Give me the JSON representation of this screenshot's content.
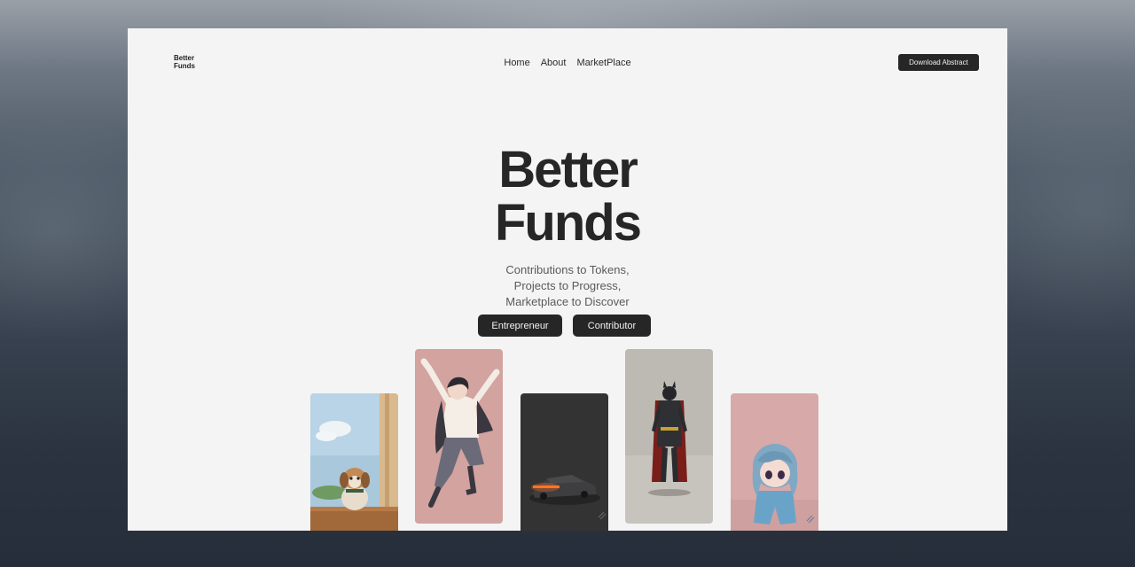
{
  "brand": {
    "line1": "Better",
    "line2": "Funds"
  },
  "nav": {
    "items": [
      "Home",
      "About",
      "MarketPlace"
    ]
  },
  "header": {
    "download_label": "Download Abstract"
  },
  "hero": {
    "title_line1": "Better",
    "title_line2": "Funds",
    "subtitle_lines": [
      "Contributions to Tokens,",
      "Projects to Progress,",
      "Marketplace to Discover"
    ]
  },
  "cta": {
    "entrepreneur": "Entrepreneur",
    "contributor": "Contributor"
  },
  "colors": {
    "page_bg": "#f4f4f4",
    "button_bg": "#262626",
    "text_dark": "#262626"
  },
  "gallery": [
    {
      "icon": "puppy-image"
    },
    {
      "icon": "jumping-person-image"
    },
    {
      "icon": "car-image"
    },
    {
      "icon": "batman-figure-image"
    },
    {
      "icon": "anime-plush-image"
    }
  ]
}
